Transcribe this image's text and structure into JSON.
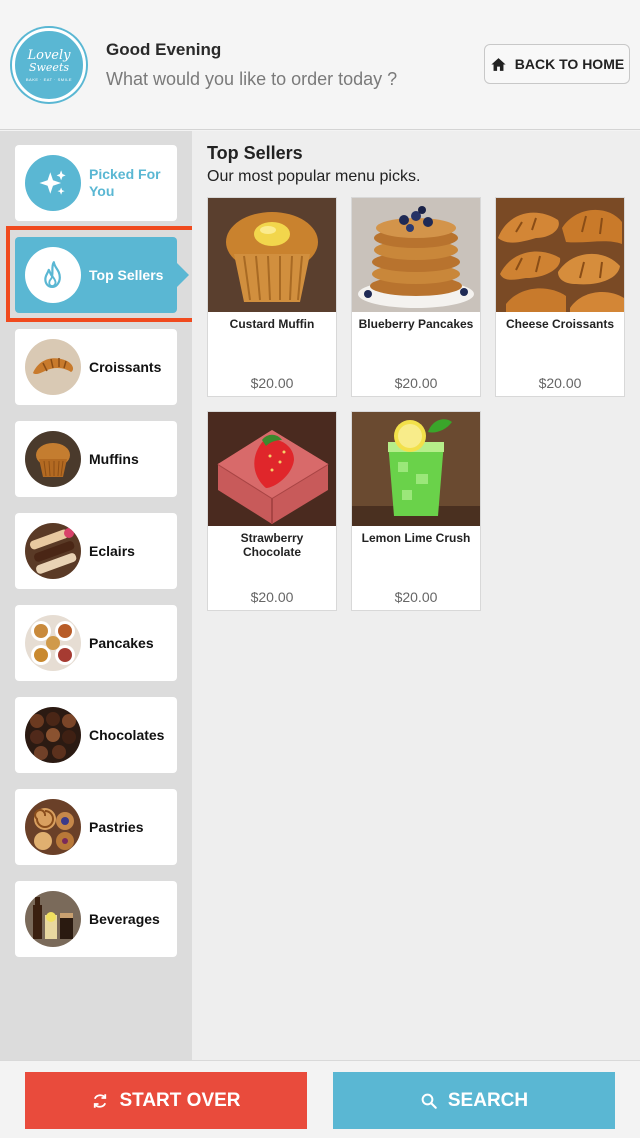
{
  "header": {
    "logo_line1": "Lovely",
    "logo_line2": "Sweets",
    "logo_tagline": "BAKE · EAT · SMILE",
    "greeting": "Good Evening",
    "prompt": "What would you like to order today ?",
    "home_button": "BACK TO HOME"
  },
  "sidebar": {
    "items": [
      {
        "label": "Picked For You",
        "icon": "sparkles-icon"
      },
      {
        "label": "Top Sellers",
        "icon": "flame-icon",
        "selected": true
      },
      {
        "label": "Croissants",
        "icon": "croissant-image"
      },
      {
        "label": "Muffins",
        "icon": "muffin-image"
      },
      {
        "label": "Eclairs",
        "icon": "eclair-image"
      },
      {
        "label": "Pancakes",
        "icon": "pancake-image"
      },
      {
        "label": "Chocolates",
        "icon": "chocolate-image"
      },
      {
        "label": "Pastries",
        "icon": "pastry-image"
      },
      {
        "label": "Beverages",
        "icon": "beverage-image"
      }
    ]
  },
  "main": {
    "title": "Top Sellers",
    "subtitle": "Our most popular menu picks.",
    "products": [
      {
        "name": "Custard Muffin",
        "price": "$20.00"
      },
      {
        "name": "Blueberry Pancakes",
        "price": "$20.00"
      },
      {
        "name": "Cheese Croissants",
        "price": "$20.00"
      },
      {
        "name": "Strawberry Chocolate",
        "price": "$20.00"
      },
      {
        "name": "Lemon Lime Crush",
        "price": "$20.00"
      }
    ]
  },
  "footer": {
    "start_over": "START OVER",
    "search": "SEARCH"
  },
  "colors": {
    "accent": "#5ab7d3",
    "danger": "#e94b3c",
    "highlight": "#f04a1e"
  }
}
